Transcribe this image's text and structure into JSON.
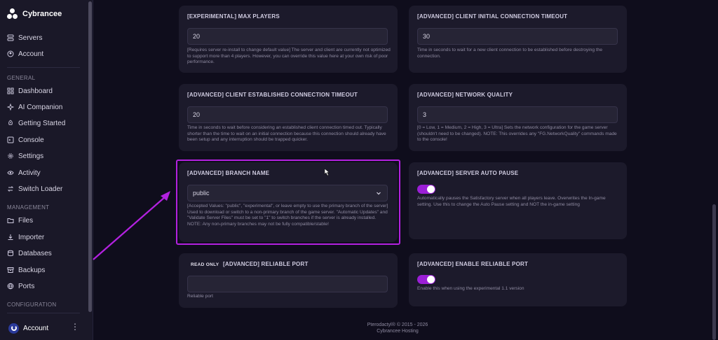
{
  "brand": {
    "name": "Cybrancee"
  },
  "nav_top": [
    {
      "label": "Servers",
      "icon": "server-icon"
    },
    {
      "label": "Account",
      "icon": "user-circle-icon"
    }
  ],
  "sections": {
    "general": "GENERAL",
    "management": "MANAGEMENT",
    "configuration": "CONFIGURATION"
  },
  "nav_general": [
    {
      "label": "Dashboard",
      "icon": "grid-icon"
    },
    {
      "label": "AI Companion",
      "icon": "sparkle-icon"
    },
    {
      "label": "Getting Started",
      "icon": "rocket-icon"
    },
    {
      "label": "Console",
      "icon": "terminal-icon"
    },
    {
      "label": "Settings",
      "icon": "gear-icon"
    },
    {
      "label": "Activity",
      "icon": "eye-icon"
    },
    {
      "label": "Switch Loader",
      "icon": "swap-icon"
    }
  ],
  "nav_management": [
    {
      "label": "Files",
      "icon": "folder-icon"
    },
    {
      "label": "Importer",
      "icon": "download-icon"
    },
    {
      "label": "Databases",
      "icon": "database-icon"
    },
    {
      "label": "Backups",
      "icon": "archive-icon"
    },
    {
      "label": "Ports",
      "icon": "network-icon"
    }
  ],
  "account_footer": {
    "label": "Account",
    "menu_glyph": "⋮"
  },
  "cards": {
    "max_players": {
      "title": "[EXPERIMENTAL] MAX PLAYERS",
      "value": "20",
      "help": "[Requires server re-install to change default value] The server and client are currently not optimized to support more than 4 players. However, you can override this value here at your own risk of poor performance."
    },
    "client_initial_timeout": {
      "title": "[ADVANCED] CLIENT INITIAL CONNECTION TIMEOUT",
      "value": "30",
      "help": "Time in seconds to wait for a new client connection to be established before destroying the connection."
    },
    "client_established_timeout": {
      "title": "[ADVANCED] CLIENT ESTABLISHED CONNECTION TIMEOUT",
      "value": "20",
      "help": "Time in seconds to wait before considering an established client connection timed out. Typically shorter than the time to wait on an initial connection because this connection should already have been setup and any interruption should be trapped quicker."
    },
    "network_quality": {
      "title": "[ADVANCED] NETWORK QUALITY",
      "value": "3",
      "help": "[0 = Low, 1 = Medium, 2 = High, 3 = Ultra] Sets the network configuration for the game server (shouldn't need to be changed). NOTE: This overrides any \"FG.NetworkQuality\" commands made to the console!"
    },
    "branch_name": {
      "title": "[ADVANCED] BRANCH NAME",
      "value": "public",
      "help": "[Accepted Values: \"public\", \"experimental\", or leave empty to use the primary branch of the server] Used to download or switch to a non-primary branch of the game server. \"Automatic Updates\" and \"Validate Server Files\" must be set to \"1\" to switch branches if the server is already installed. NOTE: Any non-primary branches may not be fully compatible/stable!"
    },
    "server_auto_pause": {
      "title": "[ADVANCED] SERVER AUTO PAUSE",
      "enabled": true,
      "help": "Automatically pauses the Satisfactory server when all players leave. Overwrites the In-game setting. Use this to change the Auto Pause setting and NOT the in-game setting"
    },
    "reliable_port": {
      "badge": "READ ONLY",
      "title": "[ADVANCED] RELIABLE PORT",
      "value": "",
      "help": "Reliable port"
    },
    "enable_reliable_port": {
      "title": "[ADVANCED] ENABLE RELIABLE PORT",
      "enabled": true,
      "help": "Enable this when using the experimental 1.1 version"
    }
  },
  "footer": {
    "line1": "Pterodactyl® © 2015 - 2026",
    "line2": "Cybrancee Hosting"
  },
  "colors": {
    "accent": "#9b1fd6",
    "highlight": "#b321e0",
    "background": "#0f0d1c",
    "card": "#1c1a2b"
  }
}
